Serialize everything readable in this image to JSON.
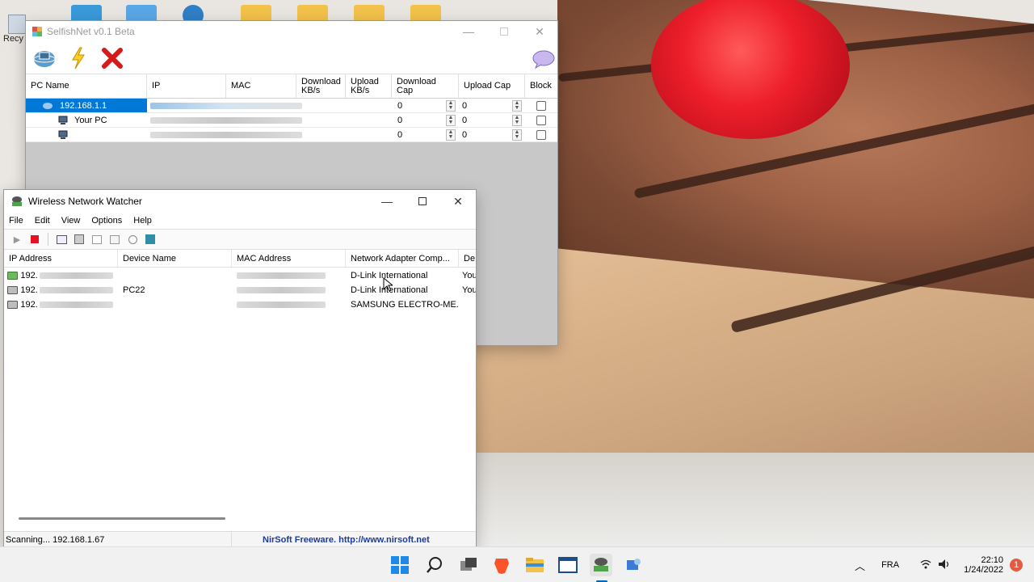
{
  "desktop": {
    "recycle_bin_label": "Recy"
  },
  "selfishnet": {
    "title": "SelfishNet v0.1 Beta",
    "toolbar": {
      "network_icon": "network-globe-icon",
      "start_icon": "lightning-icon",
      "stop_icon": "red-x-icon",
      "about_icon": "chat-bubble-icon"
    },
    "columns": [
      "PC Name",
      "IP",
      "MAC",
      "Download KB/s",
      "Upload KB/s",
      "Download Cap",
      "Upload Cap",
      "Block"
    ],
    "rows": [
      {
        "pc_name": "192.168.1.1",
        "download_cap": "0",
        "upload_cap": "0",
        "selected": true
      },
      {
        "pc_name": "Your PC",
        "download_cap": "0",
        "upload_cap": "0",
        "selected": false
      },
      {
        "pc_name": "",
        "download_cap": "0",
        "upload_cap": "0",
        "selected": false
      }
    ]
  },
  "wnw": {
    "title": "Wireless Network Watcher",
    "menu": [
      "File",
      "Edit",
      "View",
      "Options",
      "Help"
    ],
    "columns": [
      "IP Address",
      "Device Name",
      "MAC Address",
      "Network Adapter Comp...",
      "De"
    ],
    "rows": [
      {
        "ip": "192.",
        "device_name": "",
        "adapter": "D-Link International",
        "extra": "You",
        "icon": "green"
      },
      {
        "ip": "192.",
        "device_name": "PC22",
        "adapter": "D-Link International",
        "extra": "You",
        "icon": "grey"
      },
      {
        "ip": "192.",
        "device_name": "",
        "adapter": "SAMSUNG ELECTRO-ME...",
        "extra": "",
        "icon": "grey"
      }
    ],
    "status_left": "Scanning... 192.168.1.67",
    "status_right": "NirSoft Freeware.  http://www.nirsoft.net"
  },
  "taskbar": {
    "language": "FRA",
    "time": "22:10",
    "date": "1/24/2022",
    "notification_count": "1"
  },
  "colors": {
    "selection": "#0078d7",
    "nirsoft_link": "#1b3c9e",
    "stop_red": "#e81123"
  }
}
